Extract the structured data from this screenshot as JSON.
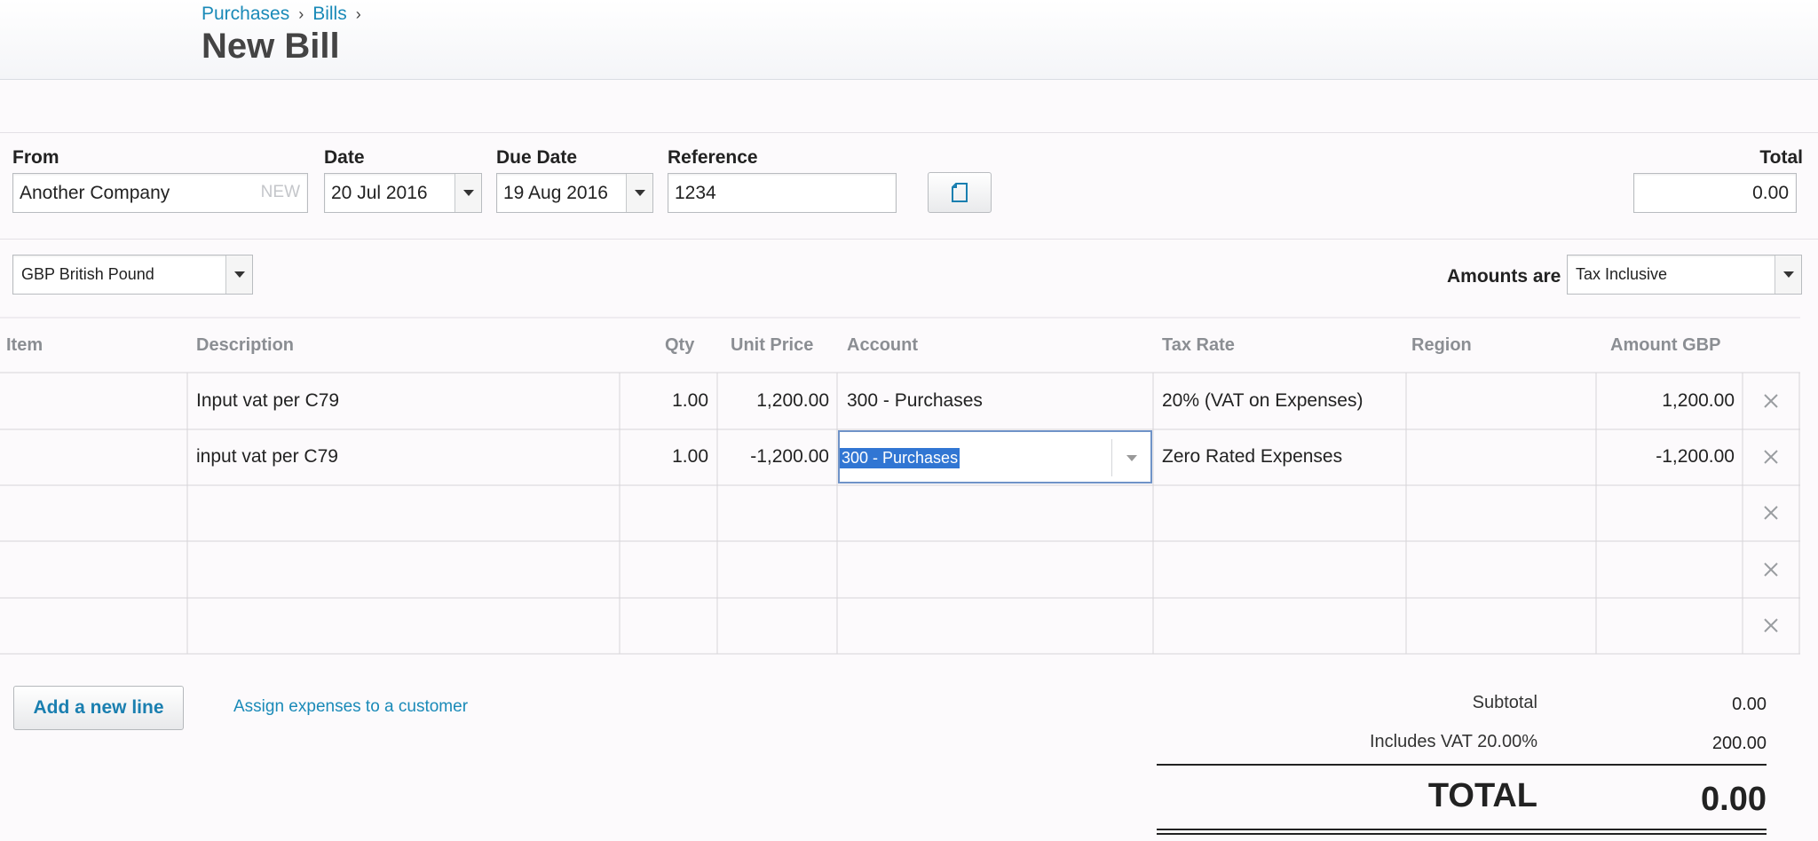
{
  "breadcrumb": {
    "purchases": "Purchases",
    "bills": "Bills",
    "separator": "›"
  },
  "page_title": "New Bill",
  "form": {
    "from_label": "From",
    "from_value": "Another Company",
    "from_new_tag": "NEW",
    "date_label": "Date",
    "date_value": "20 Jul 2016",
    "due_label": "Due Date",
    "due_value": "19 Aug 2016",
    "reference_label": "Reference",
    "reference_value": "1234",
    "total_label": "Total",
    "total_value": "0.00",
    "currency": "GBP British Pound",
    "amounts_are_label": "Amounts are",
    "amounts_are_value": "Tax Inclusive"
  },
  "columns": {
    "item": "Item",
    "description": "Description",
    "qty": "Qty",
    "unit_price": "Unit Price",
    "account": "Account",
    "tax_rate": "Tax Rate",
    "region": "Region",
    "amount": "Amount GBP"
  },
  "lines": [
    {
      "description": "Input vat per C79",
      "qty": "1.00",
      "unit_price": "1,200.00",
      "account": "300 - Purchases",
      "tax_rate": "20% (VAT on Expenses)",
      "amount": "1,200.00"
    },
    {
      "description": "input vat per C79",
      "qty": "1.00",
      "unit_price": "-1,200.00",
      "account": "300 - Purchases",
      "tax_rate": "Zero Rated Expenses",
      "amount": "-1,200.00"
    }
  ],
  "actions": {
    "add_line": "Add a new line",
    "assign": "Assign expenses to a customer"
  },
  "totals": {
    "subtotal_label": "Subtotal",
    "subtotal_value": "0.00",
    "vat_label": "Includes VAT 20.00%",
    "vat_value": "200.00",
    "total_label": "TOTAL",
    "total_value": "0.00"
  },
  "icons": {
    "document": "document-icon",
    "delete": "close-icon",
    "dropdown": "chevron-down-icon"
  },
  "colors": {
    "link": "#1a8ab8",
    "selection": "#3176d3",
    "focus_border": "#6f93c8"
  }
}
